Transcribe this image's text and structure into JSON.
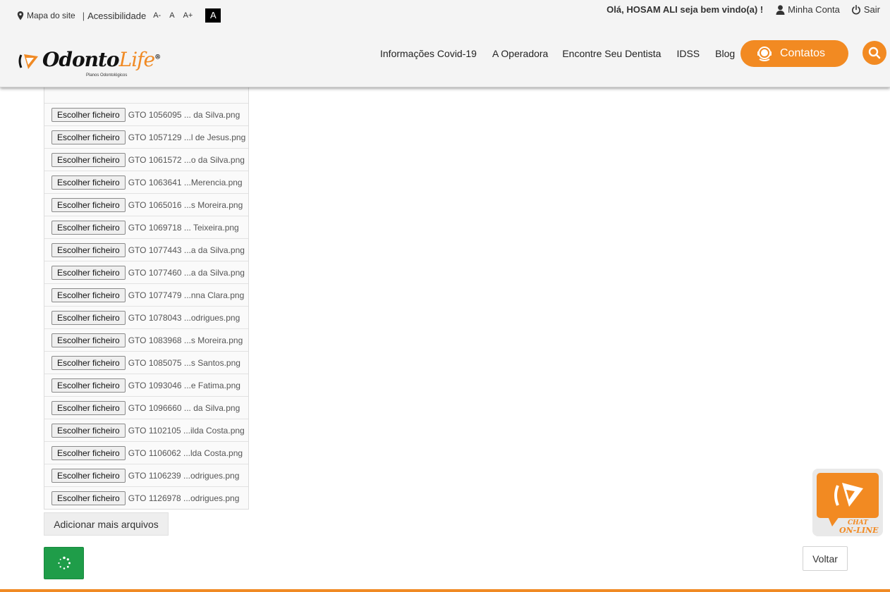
{
  "topbar": {
    "sitemap": "Mapa do site",
    "separator": "|",
    "accessibility": "Acessibilidade",
    "font_decrease": "A-",
    "font_normal": "A",
    "font_increase": "A+",
    "contrast": "A",
    "welcome": "Olá, HOSAM ALI seja bem vindo(a) !",
    "my_account": "Minha Conta",
    "logout": "Sair"
  },
  "logo": {
    "brand_main": "Odonto",
    "brand_accent": "Life",
    "registered": "®",
    "tagline": "Planos Odontológicos"
  },
  "nav": {
    "items": [
      "Informações Covid-19",
      "A Operadora",
      "Encontre Seu Dentista",
      "IDSS",
      "Blog"
    ],
    "contacts": "Contatos"
  },
  "files": {
    "choose_label": "Escolher ficheiro",
    "items": [
      "GTO 1056095 ... da Silva.png",
      "GTO 1057129 ...l de Jesus.png",
      "GTO 1061572 ...o da Silva.png",
      "GTO 1063641 ...Merencia.png",
      "GTO 1065016 ...s Moreira.png",
      "GTO 1069718 ... Teixeira.png",
      "GTO 1077443 ...a da Silva.png",
      "GTO 1077460 ...a da Silva.png",
      "GTO 1077479 ...nna Clara.png",
      "GTO 1078043 ...odrigues.png",
      "GTO 1083968 ...s Moreira.png",
      "GTO 1085075 ...s Santos.png",
      "GTO 1093046 ...e Fatima.png",
      "GTO 1096660 ... da Silva.png",
      "GTO 1102105 ...ilda Costa.png",
      "GTO 1106062 ...lda Costa.png",
      "GTO 1106239 ...odrigues.png",
      "GTO 1126978 ...odrigues.png"
    ]
  },
  "actions": {
    "add_more": "Adicionar mais arquivos",
    "back": "Voltar"
  },
  "chat": {
    "line1": "CHAT",
    "line2": "ON-LINE"
  },
  "colors": {
    "brand_orange": "#f28a22",
    "submit_green": "#1f9d49"
  }
}
